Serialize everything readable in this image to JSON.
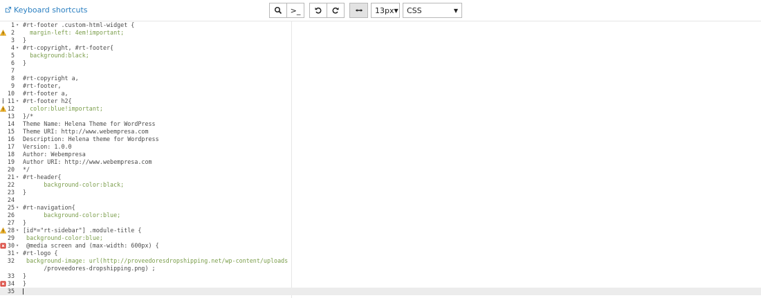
{
  "header": {
    "shortcuts_label": "Keyboard shortcuts",
    "font_size": "13px",
    "mode": "CSS",
    "toggle_label": ">_"
  },
  "editor": {
    "lines": [
      {
        "n": "1",
        "fold": true,
        "text": "#rt-footer .custom-html-widget {"
      },
      {
        "n": "2",
        "marker": "warning",
        "text": "  margin-left: 4em!important;"
      },
      {
        "n": "3",
        "text": "}"
      },
      {
        "n": "4",
        "fold": true,
        "text": "#rt-copyright, #rt-footer{"
      },
      {
        "n": "5",
        "text": "  background:black;"
      },
      {
        "n": "6",
        "text": "}"
      },
      {
        "n": "7",
        "text": ""
      },
      {
        "n": "8",
        "text": "#rt-copyright a,"
      },
      {
        "n": "9",
        "text": "#rt-footer,"
      },
      {
        "n": "10",
        "text": "#rt-footer a,"
      },
      {
        "n": "11",
        "fold": true,
        "marker": "info",
        "text": "#rt-footer h2{"
      },
      {
        "n": "12",
        "marker": "warning",
        "text": "  color:blue!important;"
      },
      {
        "n": "13",
        "text": "}/*"
      },
      {
        "n": "14",
        "text": "Theme Name: Helena Theme for WordPress"
      },
      {
        "n": "15",
        "text": "Theme URI: http://www.webempresa.com"
      },
      {
        "n": "16",
        "text": "Description: Helena theme for Wordpress"
      },
      {
        "n": "17",
        "text": "Version: 1.0.0"
      },
      {
        "n": "18",
        "text": "Author: Webempresa"
      },
      {
        "n": "19",
        "text": "Author URI: http://www.webempresa.com"
      },
      {
        "n": "20",
        "text": "*/"
      },
      {
        "n": "21",
        "fold": true,
        "text": "#rt-header{"
      },
      {
        "n": "22",
        "text": "      background-color:black;"
      },
      {
        "n": "23",
        "text": "}"
      },
      {
        "n": "24",
        "text": ""
      },
      {
        "n": "25",
        "fold": true,
        "text": "#rt-navigation{"
      },
      {
        "n": "26",
        "text": "      background-color:blue;"
      },
      {
        "n": "27",
        "text": "}"
      },
      {
        "n": "28",
        "fold": true,
        "marker": "warning",
        "text": "[id*=\"rt-sidebar\"] .module-title {"
      },
      {
        "n": "29",
        "text": " background-color:blue;"
      },
      {
        "n": "30",
        "fold": true,
        "marker": "error",
        "text": " @media screen and (max-width: 600px) {"
      },
      {
        "n": "31",
        "fold": true,
        "text": "#rt-logo {"
      },
      {
        "n": "32",
        "text": " background-image: url(http://proveedoresdropshipping.net/wp-content/uploads"
      },
      {
        "n": "",
        "text": "      /proveedores-dropshipping.png) ;"
      },
      {
        "n": "33",
        "text": "}"
      },
      {
        "n": "34",
        "marker": "error",
        "text": "}"
      },
      {
        "n": "35",
        "active": true,
        "text": ""
      }
    ]
  }
}
